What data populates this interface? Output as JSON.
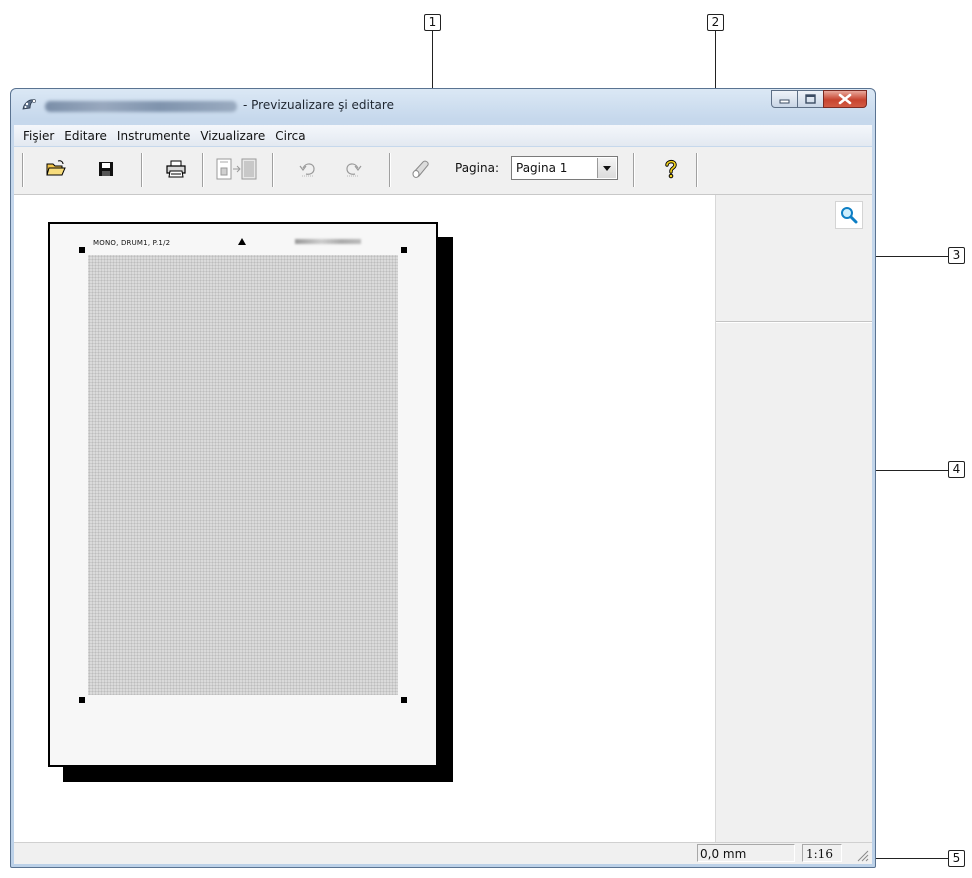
{
  "callouts": [
    "1",
    "2",
    "3",
    "4",
    "5"
  ],
  "window": {
    "title": "- Previzualizare şi editare",
    "controls": [
      "minimize-icon",
      "maximize-icon",
      "close-icon"
    ]
  },
  "menu": {
    "items": [
      "Fişier",
      "Editare",
      "Instrumente",
      "Vizualizare",
      "Circa"
    ]
  },
  "toolbar": {
    "buttons": [
      "open-folder-icon",
      "save-icon",
      "print-icon",
      "page-layout-icon",
      "undo-icon",
      "redo-icon",
      "eraser-icon",
      "help-icon"
    ],
    "page_label": "Pagina:",
    "page_value": "Pagina 1"
  },
  "preview": {
    "header_text": "MONO, DRUM1, P.1/2"
  },
  "side_panel": {
    "tool": "zoom-icon"
  },
  "status": {
    "position": "0,0 mm",
    "scale": "1:16"
  },
  "colors": {
    "accent_blue": "#c6d8ec",
    "close_red": "#c7442f",
    "toolbar_bg": "#f0f0f0"
  }
}
